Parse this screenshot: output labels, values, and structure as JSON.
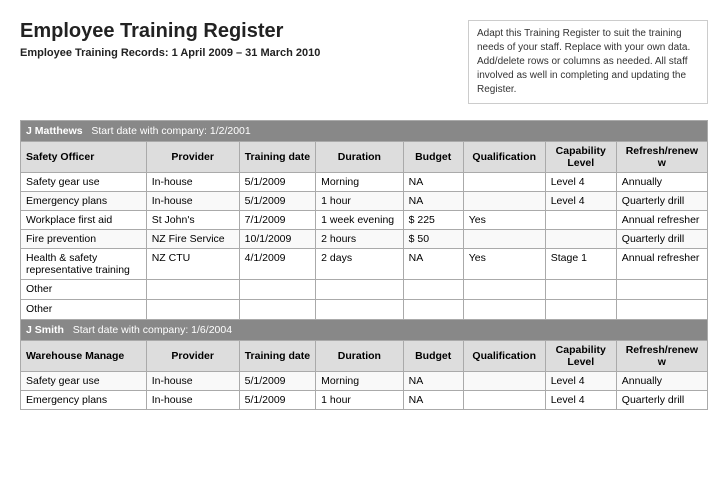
{
  "header": {
    "title": "Employee Training Register",
    "subtitle": "Employee Training Records: 1 April 2009 – 31 March 2010",
    "description": "Adapt this Training Register to suit the training needs of your staff. Replace with your own data. Add/delete rows or columns as needed. All staff involved as well in completing and updating the Register."
  },
  "columns": {
    "role": "",
    "provider": "Provider",
    "training_date": "Training date",
    "duration": "Duration",
    "budget": "Budget",
    "qualification": "Qualification",
    "capability": "Capability Level",
    "refresh": "Refresh/renew w"
  },
  "employees": [
    {
      "name": "J Matthews",
      "start": "Start date with company: 1/2/2001",
      "role": "Safety Officer",
      "trainings": [
        {
          "role": "Safety gear use",
          "provider": "In-house",
          "date": "5/1/2009",
          "duration": "Morning",
          "budget": "NA",
          "qualification": "",
          "capability": "Level 4",
          "refresh": "Annually"
        },
        {
          "role": "Emergency plans",
          "provider": "In-house",
          "date": "5/1/2009",
          "duration": "1 hour",
          "budget": "NA",
          "qualification": "",
          "capability": "Level 4",
          "refresh": "Quarterly drill"
        },
        {
          "role": "Workplace first aid",
          "provider": "St John's",
          "date": "7/1/2009",
          "duration": "1 week evening",
          "budget": "$ 225",
          "qualification": "Yes",
          "capability": "",
          "refresh": "Annual refresher"
        },
        {
          "role": "Fire prevention",
          "provider": "NZ Fire Service",
          "date": "10/1/2009",
          "duration": "2 hours",
          "budget": "$ 50",
          "qualification": "",
          "capability": "",
          "refresh": "Quarterly drill"
        },
        {
          "role": "Health & safety representative training",
          "provider": "NZ CTU",
          "date": "4/1/2009",
          "duration": "2 days",
          "budget": "NA",
          "qualification": "Yes",
          "capability": "Stage 1",
          "refresh": "Annual refresher"
        },
        {
          "role": "Other",
          "provider": "",
          "date": "",
          "duration": "",
          "budget": "",
          "qualification": "",
          "capability": "",
          "refresh": ""
        },
        {
          "role": "Other",
          "provider": "",
          "date": "",
          "duration": "",
          "budget": "",
          "qualification": "",
          "capability": "",
          "refresh": ""
        }
      ]
    },
    {
      "name": "J Smith",
      "start": "Start date with company: 1/6/2004",
      "role": "Warehouse Manage",
      "trainings": [
        {
          "role": "Safety gear use",
          "provider": "In-house",
          "date": "5/1/2009",
          "duration": "Morning",
          "budget": "NA",
          "qualification": "",
          "capability": "Level 4",
          "refresh": "Annually"
        },
        {
          "role": "Emergency plans",
          "provider": "In-house",
          "date": "5/1/2009",
          "duration": "1 hour",
          "budget": "NA",
          "qualification": "",
          "capability": "Level 4",
          "refresh": "Quarterly drill"
        }
      ]
    }
  ]
}
